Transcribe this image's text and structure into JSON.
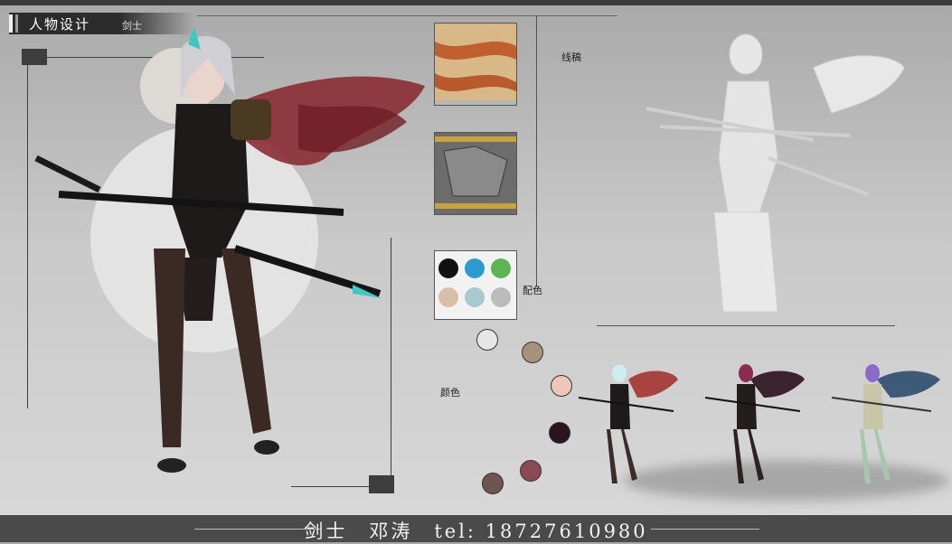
{
  "header": {
    "title": "人物设计",
    "subtitle": "剑士"
  },
  "labels": {
    "line_art": "线稿",
    "palette": "配色",
    "colors": "颜色"
  },
  "footer": {
    "role": "剑士",
    "name": "邓涛",
    "tel": "tel: 18727610980"
  },
  "color_swatches": [
    "#e6e6e6",
    "#a7917b",
    "#efc7b8",
    "#2b1420",
    "#8b4a52",
    "#6e5550"
  ],
  "material_balls": [
    "#111111",
    "#2b9bd0",
    "#5db552",
    "#d8bfa8",
    "#a9c8d0",
    "#bbbbbb"
  ],
  "accent": {
    "cape": "#8b2b33",
    "crystal": "#3ec8c0",
    "cloth": "#1e1a1a"
  }
}
